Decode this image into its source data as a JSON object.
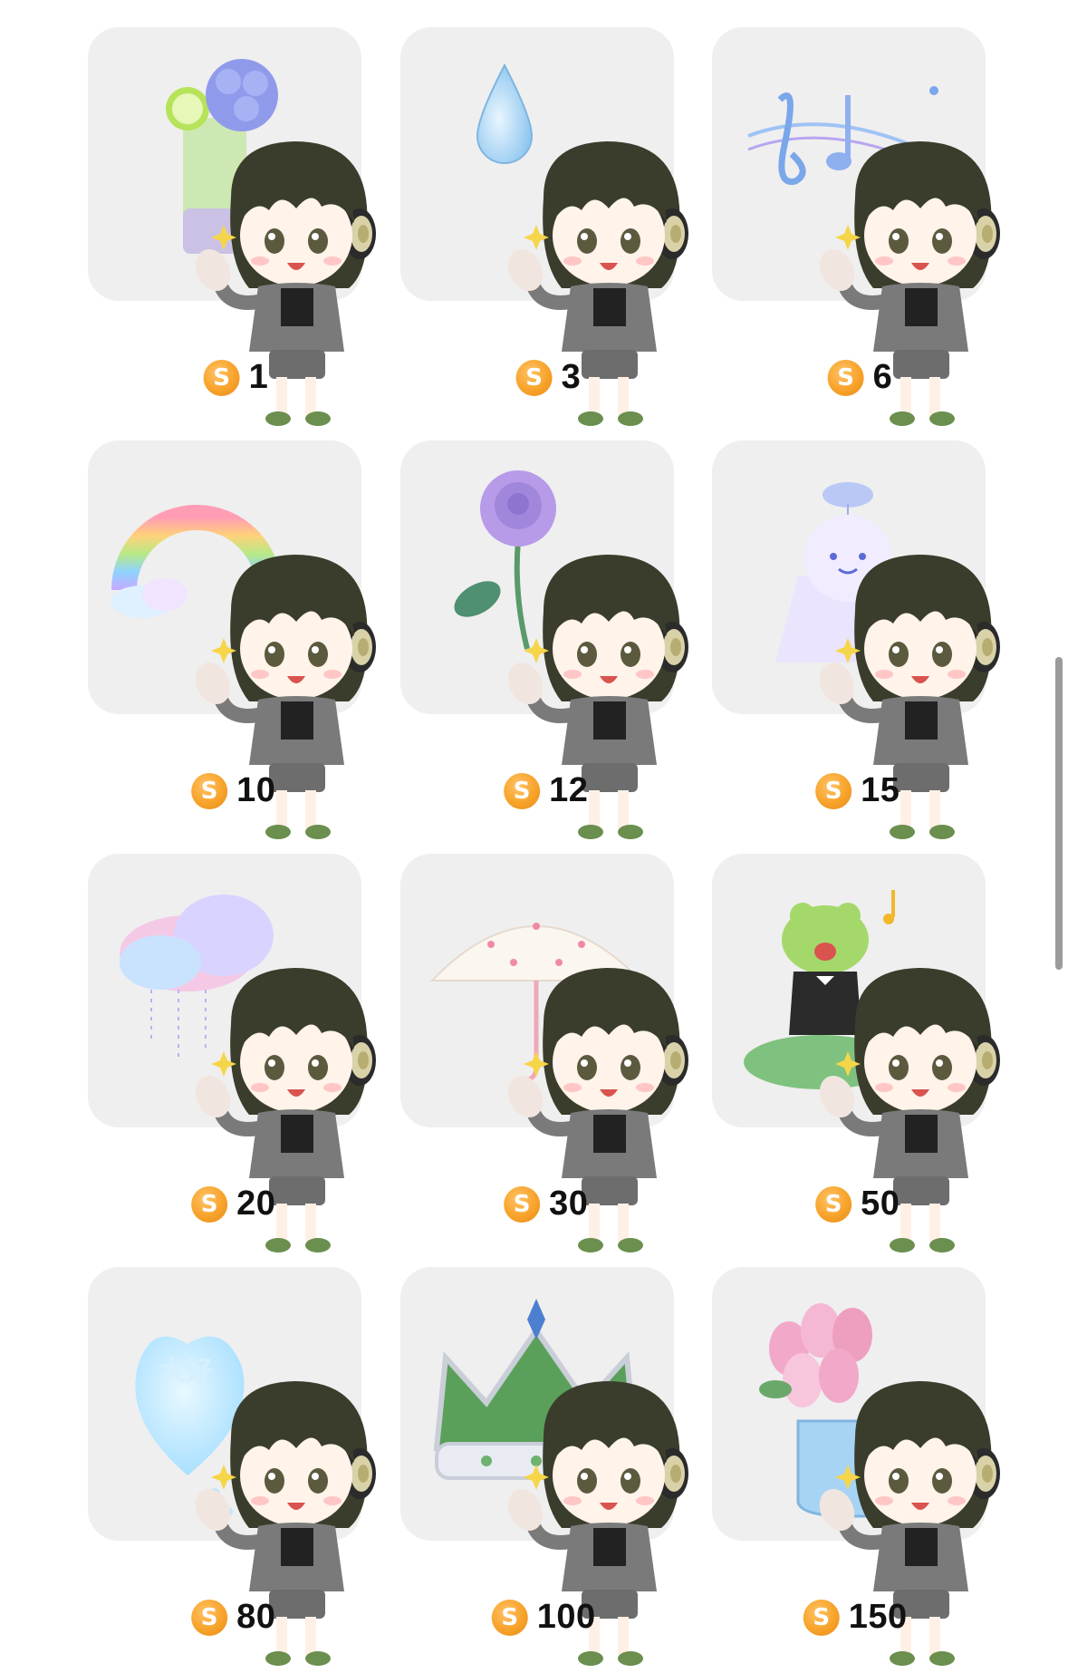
{
  "currency_symbol": "S",
  "gifts": [
    {
      "price": "1",
      "icon": "lime-hydrangea-soda-icon"
    },
    {
      "price": "3",
      "icon": "water-drop-icon"
    },
    {
      "price": "6",
      "icon": "music-notes-icon"
    },
    {
      "price": "10",
      "icon": "rainbow-icon"
    },
    {
      "price": "12",
      "icon": "purple-rose-icon"
    },
    {
      "price": "15",
      "icon": "teru-teru-bozu-icon"
    },
    {
      "price": "20",
      "icon": "rain-cloud-icon"
    },
    {
      "price": "30",
      "icon": "umbrella-icon"
    },
    {
      "price": "50",
      "icon": "singing-frog-icon"
    },
    {
      "price": "80",
      "icon": "heart-icon"
    },
    {
      "price": "100",
      "icon": "crown-icon"
    },
    {
      "price": "150",
      "icon": "tulip-boots-icon"
    }
  ],
  "heart_text": "大好",
  "colors": {
    "card_bg": "#efefef",
    "coin": "#f7a32a",
    "hair": "#3a3d2b",
    "jacket": "#7a7a7a"
  }
}
